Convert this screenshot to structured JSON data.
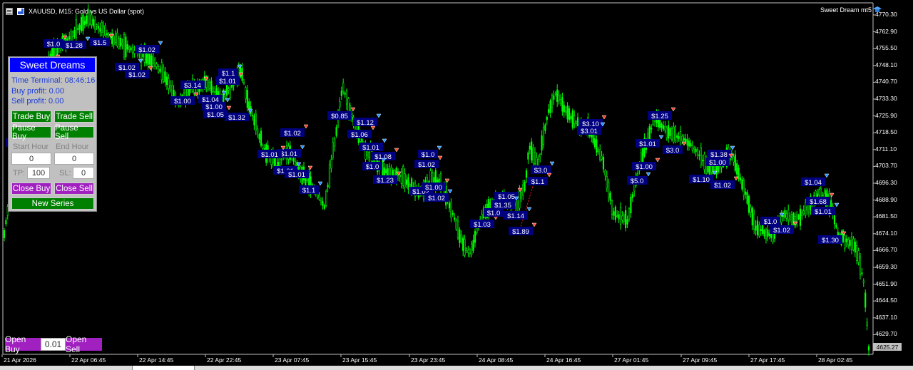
{
  "window": {
    "title": "XAUUSD, M15:  Gold vs US Dollar (spot)",
    "ea_name": "Sweet Dream mt5",
    "icons": [
      "menu-icon",
      "flag-icon",
      "graduation-cap-icon"
    ]
  },
  "panel": {
    "title": "Sweet Dreams",
    "time_terminal": "Time Terminal: 08:46:16",
    "buy_profit": "Buy profit: 0.00",
    "sell_profit": "Sell profit: 0.00",
    "trade_buy": "Trade Buy",
    "trade_sell": "Trade Sell",
    "pause_buy": "Pause Buy",
    "pause_sell": "Pause Sell",
    "start_hour_label": "Start Hour",
    "end_hour_label": "End Hour",
    "start_hour_value": "0",
    "end_hour_value": "0",
    "tp_label": "TP:",
    "tp_value": "100",
    "sl_label": "SL:",
    "sl_value": "0",
    "close_buy": "Close Buy",
    "close_sell": "Close Sell",
    "new_series": "New Series"
  },
  "bottom_controls": {
    "open_buy": "Open Buy",
    "lot": "0.01",
    "open_sell": "Open Sell"
  },
  "price_axis": {
    "labels": [
      "4770.30",
      "4762.90",
      "4755.50",
      "4748.10",
      "4740.70",
      "4733.30",
      "4725.90",
      "4718.50",
      "4711.10",
      "4703.70",
      "4696.30",
      "4688.90",
      "4681.50",
      "4674.10",
      "4666.70",
      "4659.30",
      "4651.90",
      "4644.50",
      "4637.10",
      "4629.70"
    ],
    "current_price": "4625.27"
  },
  "time_axis": {
    "labels": [
      "21 Apr 2026",
      "22 Apr 06:45",
      "22 Apr 14:45",
      "22 Apr 22:45",
      "23 Apr 07:45",
      "23 Apr 15:45",
      "23 Apr 23:45",
      "24 Apr 08:45",
      "24 Apr 16:45",
      "27 Apr 01:45",
      "27 Apr 09:45",
      "27 Apr 17:45",
      "28 Apr 02:45"
    ]
  },
  "trade_labels": [
    {
      "text": "$1.0"
    },
    {
      "text": "$1.28"
    },
    {
      "text": "$1.5"
    },
    {
      "text": "$1.02"
    },
    {
      "text": "$1.06"
    },
    {
      "text": "$1.02"
    },
    {
      "text": "$1.01"
    },
    {
      "text": "$1.00"
    },
    {
      "text": "$1.02"
    },
    {
      "text": "$1.02"
    },
    {
      "text": "$3.14"
    },
    {
      "text": "$1.1"
    },
    {
      "text": "$1.01"
    },
    {
      "text": "$1.04"
    },
    {
      "text": "$1.00"
    },
    {
      "text": "$1.00"
    },
    {
      "text": "$1.05"
    },
    {
      "text": "$1.32"
    },
    {
      "text": "$1.02"
    },
    {
      "text": "$1.01"
    },
    {
      "text": "$1.01"
    },
    {
      "text": "$1.01"
    },
    {
      "text": "$1.01"
    },
    {
      "text": "$1.1"
    },
    {
      "text": "$0.85"
    },
    {
      "text": "$1.12"
    },
    {
      "text": "$1.06"
    },
    {
      "text": "$1.01"
    },
    {
      "text": "$1.08"
    },
    {
      "text": "$1.0"
    },
    {
      "text": "$1.23"
    },
    {
      "text": "$1.0"
    },
    {
      "text": "$1.02"
    },
    {
      "text": "$1.02"
    },
    {
      "text": "$1.00"
    },
    {
      "text": "$1.02"
    },
    {
      "text": "$1.03"
    },
    {
      "text": "$1.0"
    },
    {
      "text": "$1.05"
    },
    {
      "text": "$1.35"
    },
    {
      "text": "$1.89"
    },
    {
      "text": "$3.0"
    },
    {
      "text": "$1.1"
    },
    {
      "text": "$1.14"
    },
    {
      "text": "$3.10"
    },
    {
      "text": "$3.01"
    },
    {
      "text": "$1.25"
    },
    {
      "text": "$1.01"
    },
    {
      "text": "$1.00"
    },
    {
      "text": "$5.0"
    },
    {
      "text": "$3.0"
    },
    {
      "text": "$1.38"
    },
    {
      "text": "$1.00"
    },
    {
      "text": "$1.10"
    },
    {
      "text": "$1.02"
    },
    {
      "text": "$1.0"
    },
    {
      "text": "$1.02"
    },
    {
      "text": "$1.04"
    },
    {
      "text": "$1.68"
    },
    {
      "text": "$1.01"
    },
    {
      "text": "$1.30"
    }
  ],
  "colors": {
    "background": "#000000",
    "bull_candle": "#00ff00",
    "label_bg": "#000080",
    "sell_arrow": "#ff4020",
    "buy_arrow": "#1e90ff",
    "panel_bg": "#c0c0c0",
    "panel_title": "#0000ff",
    "button_green": "#008000",
    "button_purple": "#a020c0"
  }
}
